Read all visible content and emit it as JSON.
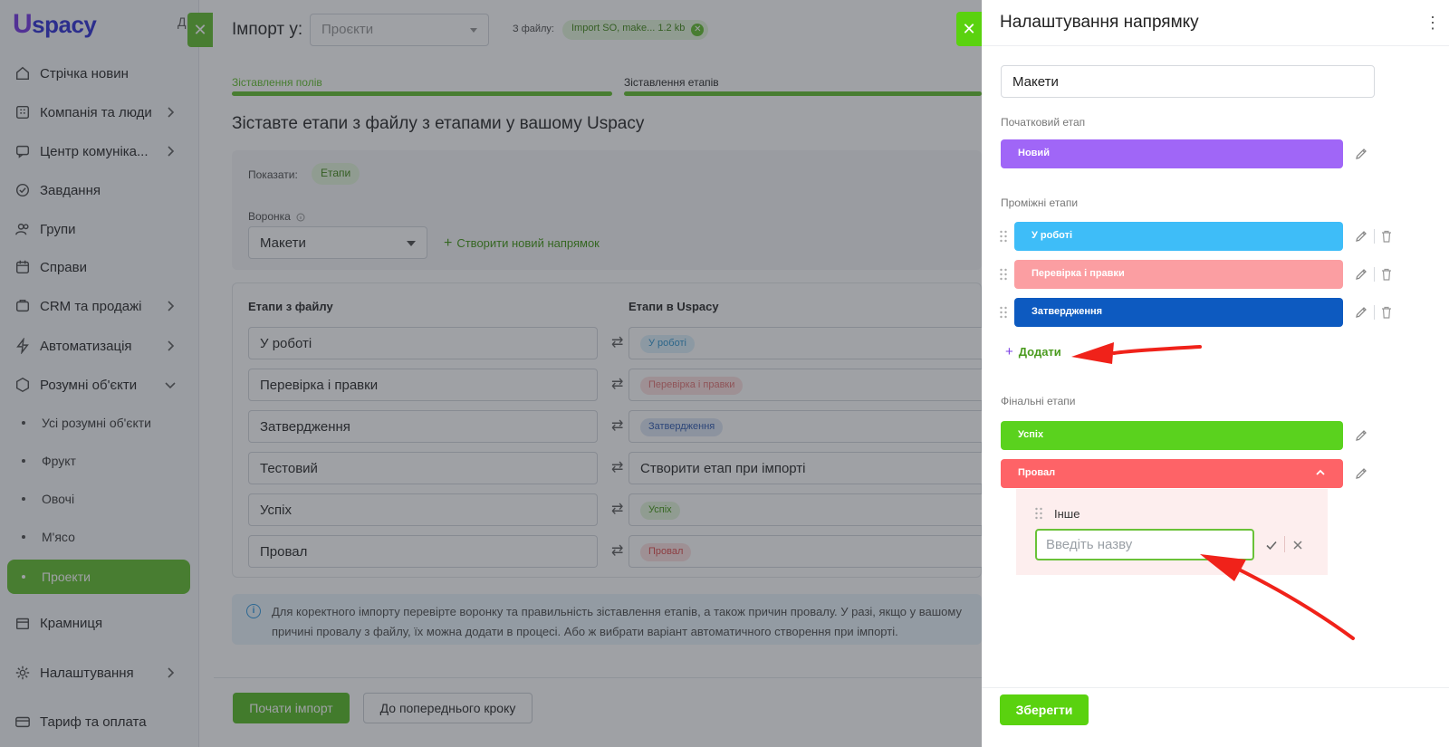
{
  "app": {
    "logo_u": "U",
    "logo_rest": "spacy",
    "logo_letter": "Д"
  },
  "sidebar": {
    "items": [
      {
        "label": "Стрічка новин",
        "icon": "home-icon"
      },
      {
        "label": "Компанія та люди",
        "icon": "building-icon"
      },
      {
        "label": "Центр комуніка...",
        "icon": "chat-icon"
      },
      {
        "label": "Завдання",
        "icon": "check-circle-icon"
      },
      {
        "label": "Групи",
        "icon": "users-icon"
      },
      {
        "label": "Справи",
        "icon": "calendar-icon"
      },
      {
        "label": "CRM та продажі",
        "icon": "crm-icon"
      },
      {
        "label": "Автоматизація",
        "icon": "lightning-icon"
      },
      {
        "label": "Розумні об'єкти",
        "icon": "smart-object-icon"
      }
    ],
    "sub_items": [
      "Усі розумні об'єкти",
      "Фрукт",
      "Овочі",
      "М'ясо"
    ],
    "active_item": "Проекти",
    "bottom_items": [
      {
        "label": "Крамниця",
        "icon": "store-icon"
      },
      {
        "label": "Налаштування",
        "icon": "gear-icon"
      },
      {
        "label": "Тариф та оплата",
        "icon": "card-icon"
      }
    ]
  },
  "import": {
    "title": "Імпорт у:",
    "entity_placeholder": "Проєкти",
    "file_label": "З файлу:",
    "file_chip": "Import SO, make... 1.2 kb",
    "steps": [
      "Зіставлення полів",
      "Зіставлення етапів"
    ],
    "heading": "Зіставте етапи з файлу з етапами у вашому Uspacy",
    "show_label": "Показати:",
    "show_chip": "Етапи",
    "funnel_label": "Воронка",
    "funnel_value": "Макети",
    "create_link": "Створити новий напрямок",
    "col_file": "Етапи з файлу",
    "col_uspacy": "Етапи в Uspacy",
    "rows": [
      {
        "file": "У роботі",
        "target": "У роботі",
        "kind": "chip",
        "bg": "#dff1fb",
        "fg": "#3a9ad0"
      },
      {
        "file": "Перевірка і правки",
        "target": "Перевірка і правки",
        "kind": "chip",
        "bg": "#fde2e2",
        "fg": "#e47a7a"
      },
      {
        "file": "Затвердження",
        "target": "Затвердження",
        "kind": "chip",
        "bg": "#dfe7f5",
        "fg": "#3a62b4"
      },
      {
        "file": "Тестовий",
        "target": "Створити етап при імпорті",
        "kind": "text",
        "bg": "",
        "fg": "#333333"
      },
      {
        "file": "Успіх",
        "target": "Успіх",
        "kind": "chip",
        "bg": "#e6f6dc",
        "fg": "#4a9b1e"
      },
      {
        "file": "Провал",
        "target": "Провал",
        "kind": "chip",
        "bg": "#fde2e2",
        "fg": "#e05555"
      }
    ],
    "info_line1": "Для коректного імпорту перевірте воронку та правильність зіставлення етапів, а також причин провалу. У разі, якщо у вашому",
    "info_line2": "причині провалу з файлу, їх можна додати в процесі. Або ж вибрати варіант автоматичного створення при імпорті.",
    "start_button": "Почати імпорт",
    "back_button": "До попереднього кроку"
  },
  "drawer": {
    "title": "Налаштування напрямку",
    "name_value": "Макети",
    "initial_label": "Початковий етап",
    "initial_stage": {
      "label": "Новий",
      "color": "#a066f7"
    },
    "intermediate_label": "Проміжні етапи",
    "intermediate_stages": [
      {
        "label": "У роботі",
        "color": "#3ebdf8"
      },
      {
        "label": "Перевірка і правки",
        "color": "#fb9ea2"
      },
      {
        "label": "Затвердження",
        "color": "#0d5ac0"
      }
    ],
    "add_label": "Додати",
    "final_label": "Фінальні етапи",
    "final_stages": [
      {
        "label": "Успіх",
        "color": "#5ad21e"
      },
      {
        "label": "Провал",
        "color": "#fe6367"
      }
    ],
    "loss_reason": "Інше",
    "reason_placeholder": "Введіть назву",
    "save_button": "Зберегти"
  },
  "colors": {
    "accent_green": "#5ad20f",
    "annotation_red": "#f0221a"
  }
}
